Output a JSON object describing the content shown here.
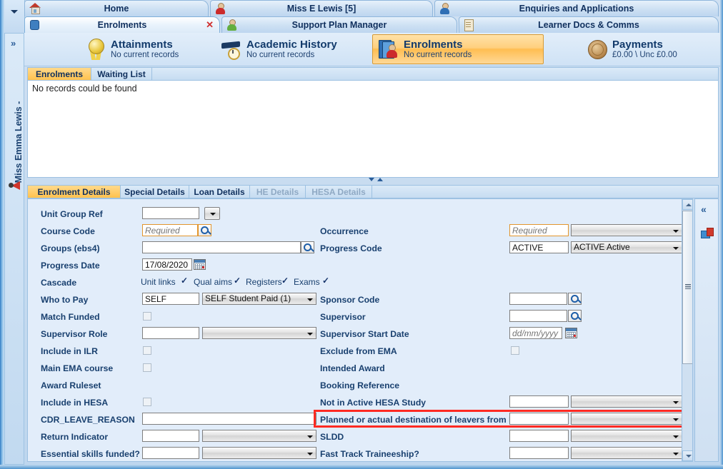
{
  "window": {
    "top_tabs_row1": [
      {
        "label": "Home",
        "icon": "home-icon",
        "active": false
      },
      {
        "label": "Miss E Lewis [5]",
        "icon": "person-red-icon",
        "active": false
      },
      {
        "label": "Enquiries and Applications",
        "icon": "person-blue-icon",
        "active": false
      }
    ],
    "top_tabs_row2": [
      {
        "label": "Enrolments",
        "icon": "cylinder-person-icon",
        "active": true,
        "closable": true,
        "close_label": "✕"
      },
      {
        "label": "Support Plan Manager",
        "icon": "person-green-icon",
        "active": false
      },
      {
        "label": "Learner Docs & Comms",
        "icon": "document-icon",
        "active": false
      }
    ]
  },
  "left_rail": {
    "expand_label": "»",
    "vertical_title": "Miss Emma Lewis -",
    "alert_icon": "megaphone-icon"
  },
  "summary_bar": {
    "cards": [
      {
        "title": "Attainments",
        "subtitle": "No current records",
        "icon": "rosette-icon",
        "selected": false
      },
      {
        "title": "Academic History",
        "subtitle": "No current records",
        "icon": "graduation-cap-clock-icon",
        "selected": false
      },
      {
        "title": "Enrolments",
        "subtitle": "No current records",
        "icon": "book-person-icon",
        "selected": true
      },
      {
        "title": "Payments",
        "subtitle": "£0.00 \\ Unc £0.00",
        "icon": "coin-icon",
        "selected": false
      }
    ]
  },
  "grid_panel": {
    "tabs": [
      {
        "label": "Enrolments",
        "active": true
      },
      {
        "label": "Waiting List",
        "active": false
      }
    ],
    "empty_message": "No records could be found"
  },
  "detail_tabs": [
    {
      "label": "Enrolment Details",
      "active": true,
      "disabled": false
    },
    {
      "label": "Special Details",
      "active": false,
      "disabled": false
    },
    {
      "label": "Loan Details",
      "active": false,
      "disabled": false
    },
    {
      "label": "HE Details",
      "active": false,
      "disabled": true
    },
    {
      "label": "HESA Details",
      "active": false,
      "disabled": true
    }
  ],
  "form": {
    "left_column": {
      "unit_group_ref": {
        "label": "Unit Group Ref",
        "value": ""
      },
      "course_code": {
        "label": "Course Code",
        "value": "",
        "placeholder": "Required"
      },
      "groups_ebs4": {
        "label": "Groups (ebs4)",
        "value": ""
      },
      "progress_date": {
        "label": "Progress Date",
        "value": "17/08/2020"
      },
      "cascade": {
        "label": "Cascade",
        "items": [
          {
            "label": "Unit links",
            "checked": true
          },
          {
            "label": "Qual aims",
            "checked": true
          },
          {
            "label": "Registers",
            "checked": true
          },
          {
            "label": "Exams",
            "checked": true
          }
        ]
      },
      "who_to_pay": {
        "label": "Who to Pay",
        "code": "SELF",
        "description": "SELF Student Paid (1)"
      },
      "match_funded": {
        "label": "Match Funded",
        "checked": false
      },
      "supervisor_role": {
        "label": "Supervisor Role",
        "code": "",
        "description": ""
      },
      "include_in_ilr": {
        "label": "Include in ILR",
        "checked": false
      },
      "main_ema_course": {
        "label": "Main EMA course",
        "checked": false
      },
      "award_ruleset": {
        "label": "Award Ruleset"
      },
      "include_in_hesa": {
        "label": "Include in HESA",
        "checked": false
      },
      "cdr_leave_reason": {
        "label": "CDR_LEAVE_REASON",
        "value": ""
      },
      "return_indicator": {
        "label": "Return Indicator",
        "code": "",
        "description": ""
      },
      "essential_skills_funded": {
        "label": "Essential skills funded?",
        "code": "",
        "description": ""
      }
    },
    "right_column": {
      "occurrence": {
        "label": "Occurrence",
        "value": "",
        "placeholder": "Required",
        "description": ""
      },
      "progress_code": {
        "label": "Progress Code",
        "code": "ACTIVE",
        "description": "ACTIVE Active"
      },
      "sponsor_code": {
        "label": "Sponsor Code",
        "value": ""
      },
      "supervisor": {
        "label": "Supervisor",
        "value": ""
      },
      "supervisor_start_date": {
        "label": "Supervisor Start Date",
        "value": "",
        "placeholder": "dd/mm/yyyy"
      },
      "exclude_from_ema": {
        "label": "Exclude from EMA",
        "checked": false
      },
      "intended_award": {
        "label": "Intended Award"
      },
      "booking_reference": {
        "label": "Booking Reference"
      },
      "not_in_active_hesa_study": {
        "label": "Not in Active HESA Study",
        "code": "",
        "description": ""
      },
      "planned_destination": {
        "label": "Planned or actual destination of leavers from FE",
        "code": "",
        "description": "",
        "highlighted": true
      },
      "sldd": {
        "label": "SLDD",
        "code": "",
        "description": ""
      },
      "fast_track_traineeship": {
        "label": "Fast Track Traineeship?",
        "code": "",
        "description": ""
      }
    }
  },
  "right_panel": {
    "collapse_label": "«",
    "pin_icon": "pin-icon"
  },
  "colors": {
    "accent_orange": "#ffc24e",
    "highlight_red": "#ff2a22",
    "label_blue": "#19406f",
    "panel_bg": "#e2edfa"
  }
}
